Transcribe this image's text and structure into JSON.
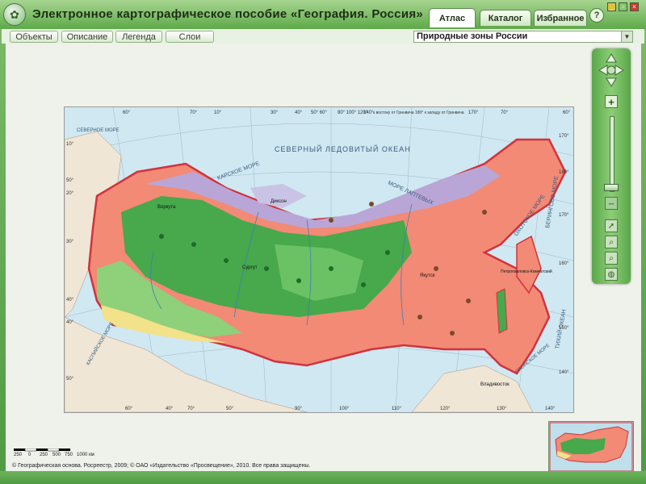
{
  "app": {
    "title": "Электронное картографическое пособие «География. Россия»"
  },
  "tabs": [
    {
      "label": "Атлас",
      "active": true
    },
    {
      "label": "Каталог",
      "active": false
    },
    {
      "label": "Избранное",
      "active": false
    }
  ],
  "help": {
    "label": "?"
  },
  "toolbar": {
    "buttons": [
      "Объекты",
      "Описание",
      "Легенда",
      "Слои"
    ]
  },
  "map_select": {
    "value": "Природные зоны России"
  },
  "map": {
    "longitudes_top": [
      "60°",
      "70°",
      "10°",
      "30°",
      "40°",
      "50° 60°",
      "80° 100° 120°",
      "140°",
      "170°",
      "70°",
      "60°"
    ],
    "note_top": "к востоку от Гринвича 180° к западу от Гринвича",
    "longitudes_bottom": [
      "60°",
      "40°",
      "70°",
      "50°",
      "90°",
      "100°",
      "110°",
      "120°",
      "130°",
      "140°"
    ],
    "latitudes_left": [
      "10°",
      "50°",
      "20°",
      "30°",
      "40°",
      "40°",
      "50°"
    ],
    "latitudes_right": [
      "170°",
      "180°",
      "170°",
      "160°",
      "150°",
      "140°"
    ],
    "labels": {
      "ocean_north": "СЕВЕРНЫЙ ЛЕДОВИТЫЙ ОКЕАН",
      "sea_okhotsk": "ОХОТСКОЕ МОРЕ",
      "sea_bering": "БЕРИНГОВО МОРЕ",
      "sea_laptev": "МОРЕ ЛАПТЕВЫХ",
      "sea_kara": "КАРСКОЕ МОРЕ",
      "sea_japan": "ЯПОНСКОЕ МОРЕ",
      "pacific": "ТИХИЙ ОКЕАН",
      "sea_north": "СЕВЕРНОЕ МОРЕ",
      "sea_caspian": "КАСПИЙСКОЕ МОРЕ",
      "yakutsk": "Якутск",
      "dikson": "Диксон",
      "vorkuta": "Воркута",
      "surgut": "Сургут",
      "vladivostok": "Владивосток",
      "petropavlovsk": "Петропавловск-Камчатский"
    },
    "zone_colors": {
      "arctic_desert": "#c9c3e6",
      "tundra": "#b9a6d6",
      "taiga": "#47a84c",
      "mixed_forest": "#8fd07a",
      "steppe": "#f2e28a",
      "mountain": "#f28a75",
      "water": "#cfe8f2"
    }
  },
  "scale": {
    "labels": [
      "250",
      "0",
      "250",
      "500",
      "750",
      "1000 км"
    ]
  },
  "copyright": "© Географическая основа. Росреестр, 2009; © ОАО «Издательство «Просвещение», 2010. Все права защищены."
}
